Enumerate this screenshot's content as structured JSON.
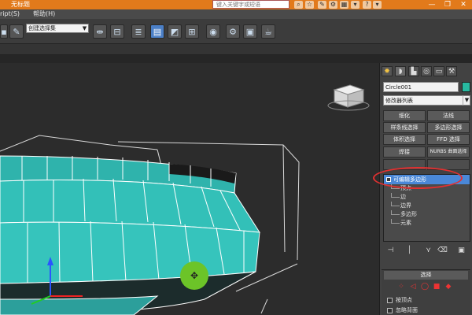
{
  "titlebar": {
    "title": "无标题",
    "search_placeholder": "键入关键字或短语",
    "close": "✕",
    "restore": "❐",
    "minimize": "—"
  },
  "menu": {
    "script_item": "ript(S)",
    "help_item": "帮助(H)"
  },
  "toolbar": {
    "selection_set": "创建选择集"
  },
  "panel": {
    "object_name": "Circle001",
    "modifier_list": "修改器列表",
    "buttons": [
      "细化",
      "法线",
      "样条线选择",
      "多边形选择",
      "体积选择",
      "FFD 选择",
      "焊接",
      "NURBS 曲面选择"
    ],
    "stack_top": "可编辑多边形",
    "sub_objects": [
      "顶点",
      "边",
      "边界",
      "多边形",
      "元素"
    ],
    "object_color": "#27b9a0"
  },
  "rollout": {
    "title": "选择",
    "options": [
      "按顶点",
      "忽略背面"
    ]
  },
  "viewport": {
    "cube_label": ""
  }
}
